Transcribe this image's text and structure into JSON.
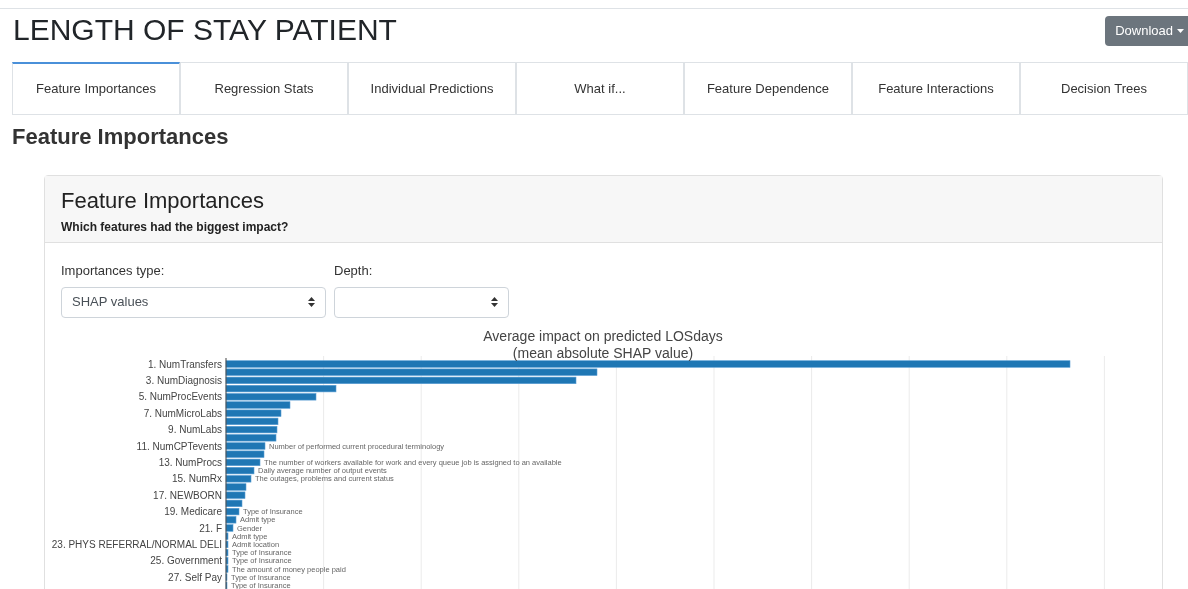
{
  "page_title": "LENGTH OF STAY PATIENT",
  "download_button": "Download",
  "tabs": [
    {
      "label": "Feature Importances",
      "selected": true
    },
    {
      "label": "Regression Stats",
      "selected": false
    },
    {
      "label": "Individual Predictions",
      "selected": false
    },
    {
      "label": "What if...",
      "selected": false
    },
    {
      "label": "Feature Dependence",
      "selected": false
    },
    {
      "label": "Feature Interactions",
      "selected": false
    },
    {
      "label": "Decision Trees",
      "selected": false
    }
  ],
  "section_heading": "Feature Importances",
  "card": {
    "title": "Feature Importances",
    "subtitle": "Which features had the biggest impact?",
    "controls": [
      {
        "label": "Importances type:",
        "value": "SHAP values"
      },
      {
        "label": "Depth:"
      }
    ],
    "chart": {
      "title_lines": [
        "Average impact on predicted LOSdays",
        "(mean absolute SHAP value)"
      ],
      "rows": [
        {
          "label": "1. NumTransfers"
        },
        {},
        {
          "label": "3. NumDiagnosis"
        },
        {},
        {
          "label": "5. NumProcEvents"
        },
        {},
        {
          "label": "7. NumMicroLabs"
        },
        {},
        {
          "label": "9. NumLabs"
        },
        {},
        {
          "label": "11. NumCPTevents",
          "note": "Number of performed current procedural terminology"
        },
        {},
        {
          "label": "13. NumProcs",
          "note": "The number of workers available for work and every queue job is assigned to an available"
        },
        {
          "note": "Daily average number of output events"
        },
        {
          "label": "15. NumRx",
          "note": "The outages, problems and current status"
        },
        {},
        {
          "label": "17. NEWBORN"
        },
        {},
        {
          "label": "19. Medicare",
          "note": "Type of Insurance"
        },
        {
          "note": "Admit type"
        },
        {
          "label": "21. F",
          "note": "Gender"
        },
        {
          "note": "Admit type"
        },
        {
          "label": "23. PHYS REFERRAL/NORMAL DELI",
          "note": "Admit location"
        },
        {
          "note": "Type of Insurance"
        },
        {
          "label": "25. Government",
          "note": "Type of Insurance"
        },
        {
          "note": "The amount of money people paid"
        },
        {
          "label": "27. Self Pay",
          "note": "Type of Insurance"
        },
        {
          "note": "Type of Insurance"
        }
      ]
    }
  }
}
